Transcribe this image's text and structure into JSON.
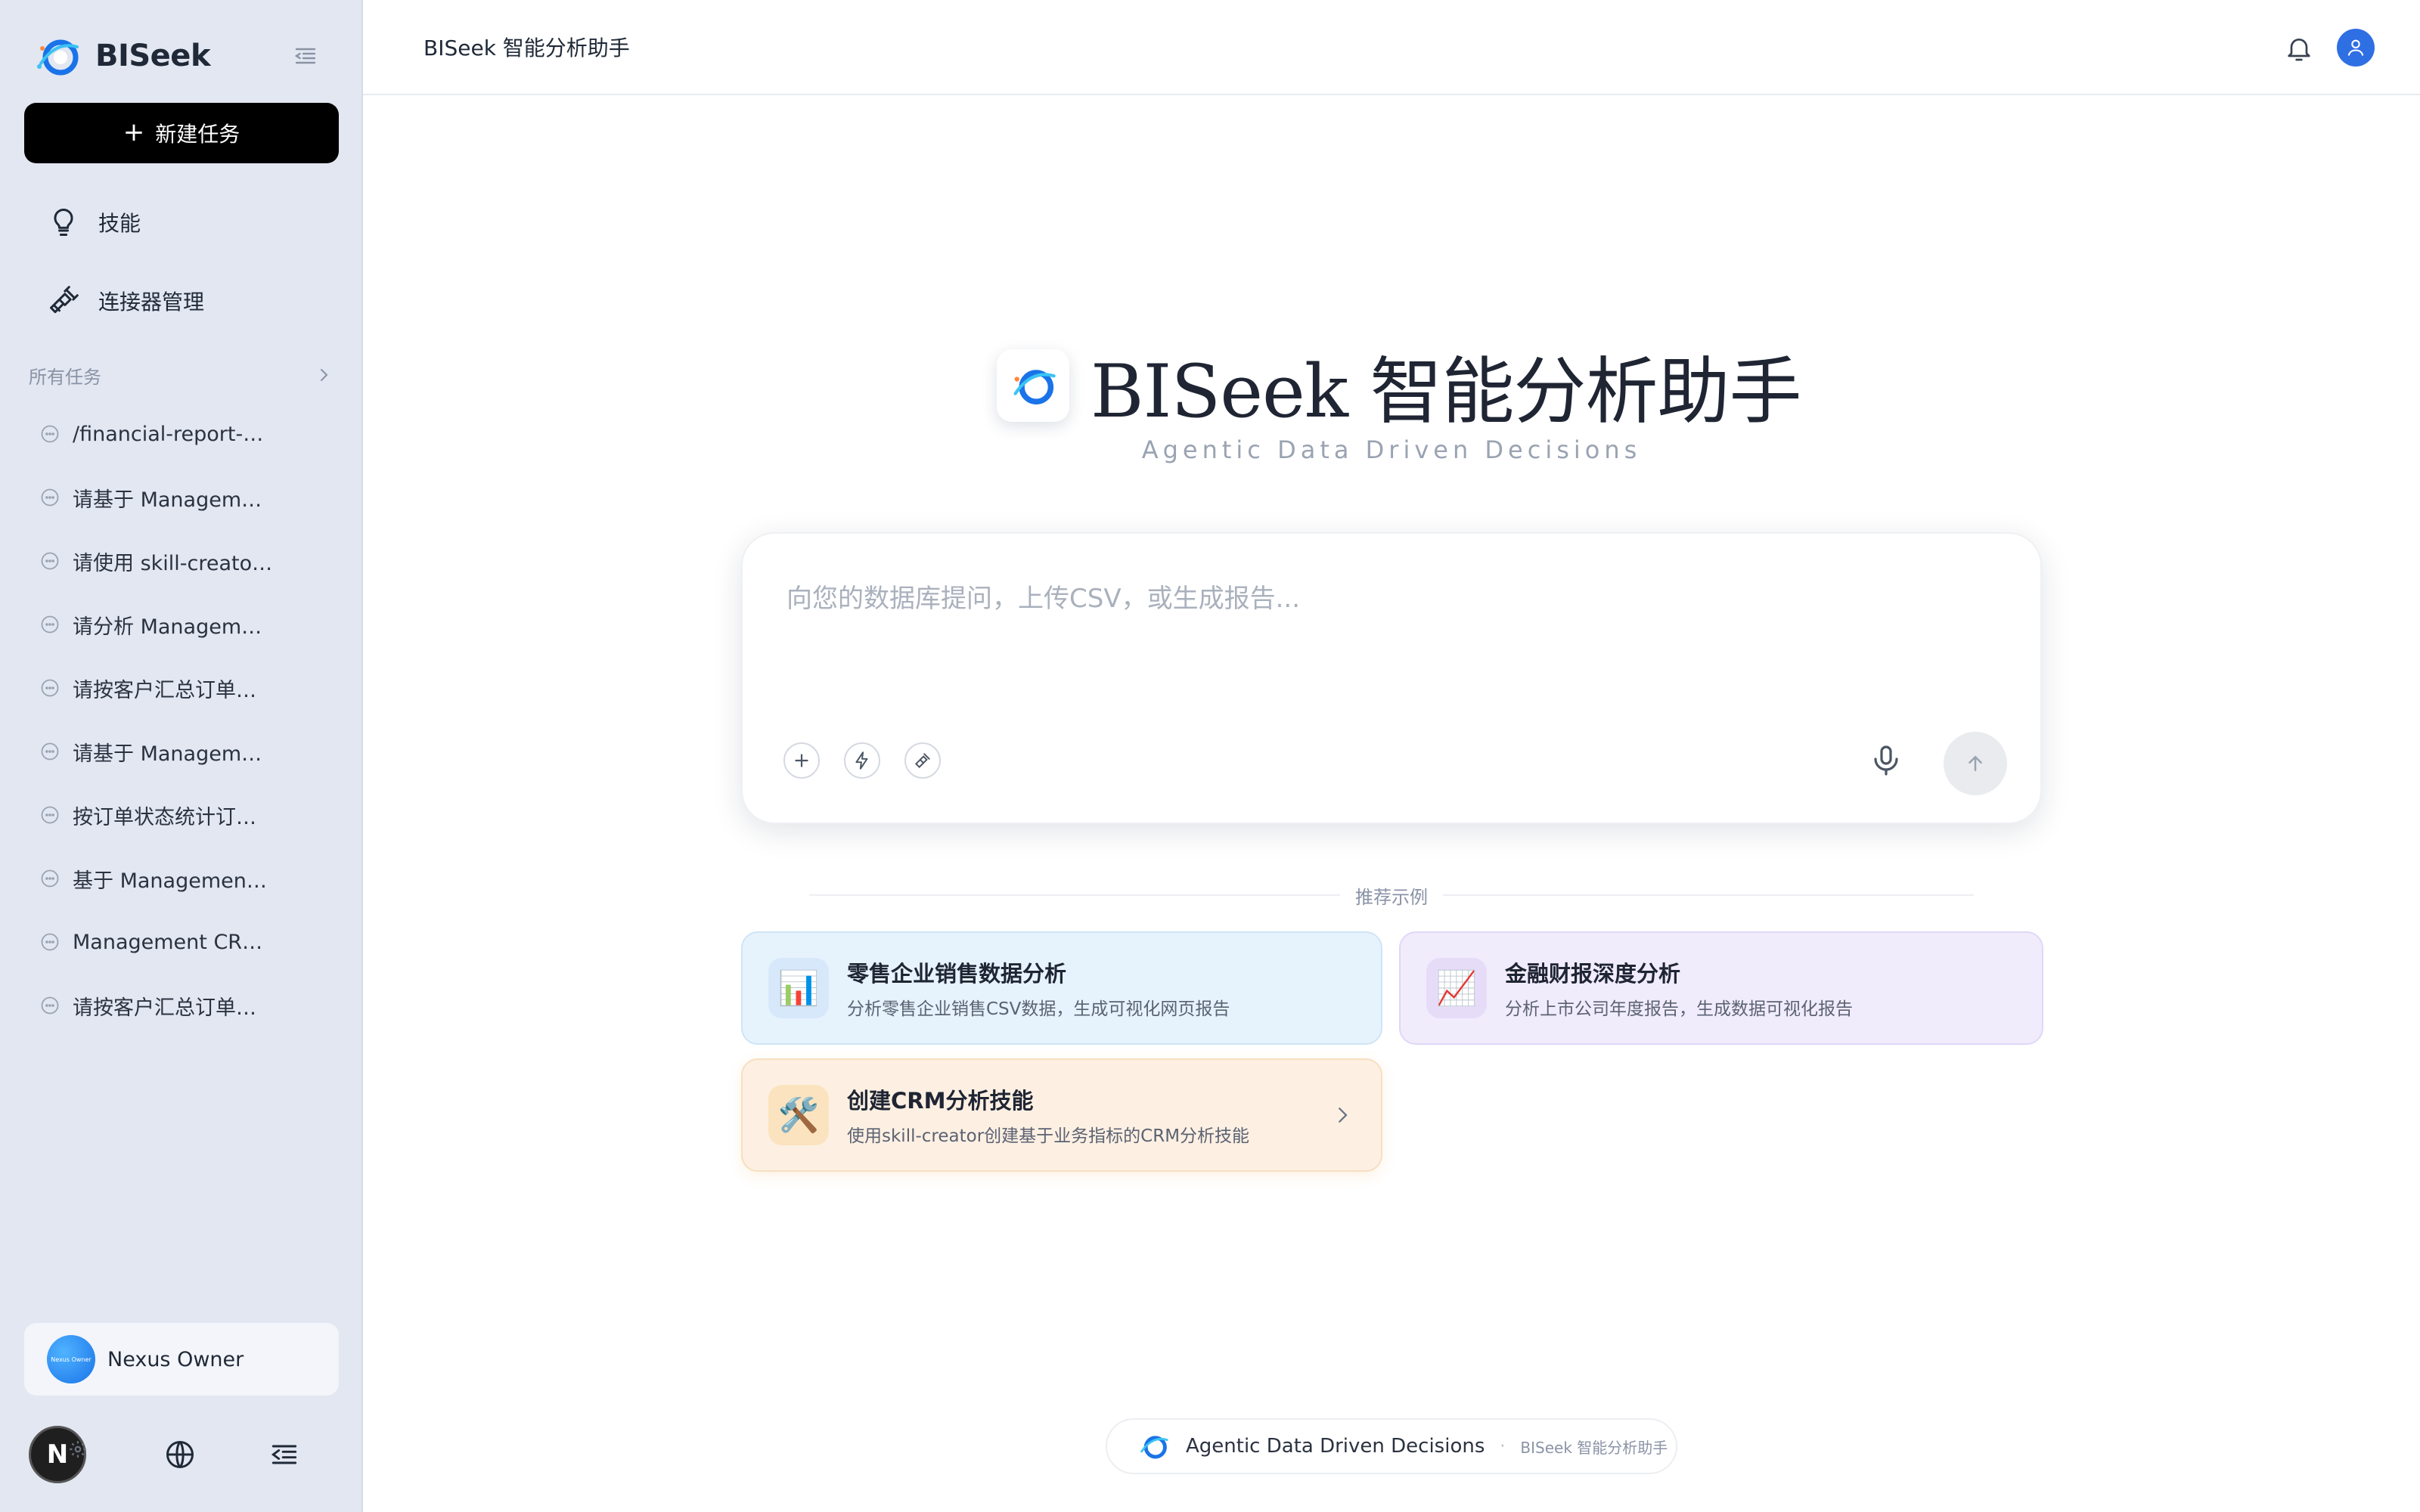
{
  "colors": {
    "accent": "#1a73e8",
    "sidebar_bg": "#e2e7f1",
    "new_task_bg": "#000000"
  },
  "sidebar": {
    "brand": "BISeek",
    "new_task_label": "新建任务",
    "nav": [
      {
        "label": "技能",
        "icon": "lightbulb-icon"
      },
      {
        "label": "连接器管理",
        "icon": "plug-icon"
      }
    ],
    "section_title": "所有任务",
    "tasks": [
      "/financial-report-an…",
      "请基于 Manageme…",
      "请使用 skill-creator…",
      "请分析 Manageme…",
      "请按客户汇总订单…",
      "请基于 Manageme…",
      "按订单状态统计订…",
      "基于 Management …",
      "Management CRM…",
      "请按客户汇总订单…"
    ],
    "user": {
      "name": "Nexus Owner",
      "avatar_text": "Nexus Owner"
    },
    "badge": "N"
  },
  "header": {
    "title": "BISeek 智能分析助手"
  },
  "hero": {
    "title": "BISeek 智能分析助手",
    "subtitle": "Agentic Data Driven Decisions"
  },
  "prompt": {
    "placeholder": "向您的数据库提问，上传CSV，或生成报告..."
  },
  "recommended": {
    "label": "推荐示例",
    "cards": [
      {
        "title": "零售企业销售数据分析",
        "desc": "分析零售企业销售CSV数据，生成可视化网页报告",
        "icon": "📊"
      },
      {
        "title": "金融财报深度分析",
        "desc": "分析上市公司年度报告，生成数据可视化报告",
        "icon": "📈"
      },
      {
        "title": "创建CRM分析技能",
        "desc": "使用skill-creator创建基于业务指标的CRM分析技能",
        "icon": "🛠️"
      }
    ]
  },
  "footer": {
    "main": "Agentic Data Driven Decisions",
    "sep": "·",
    "sub": "BISeek 智能分析助手"
  }
}
